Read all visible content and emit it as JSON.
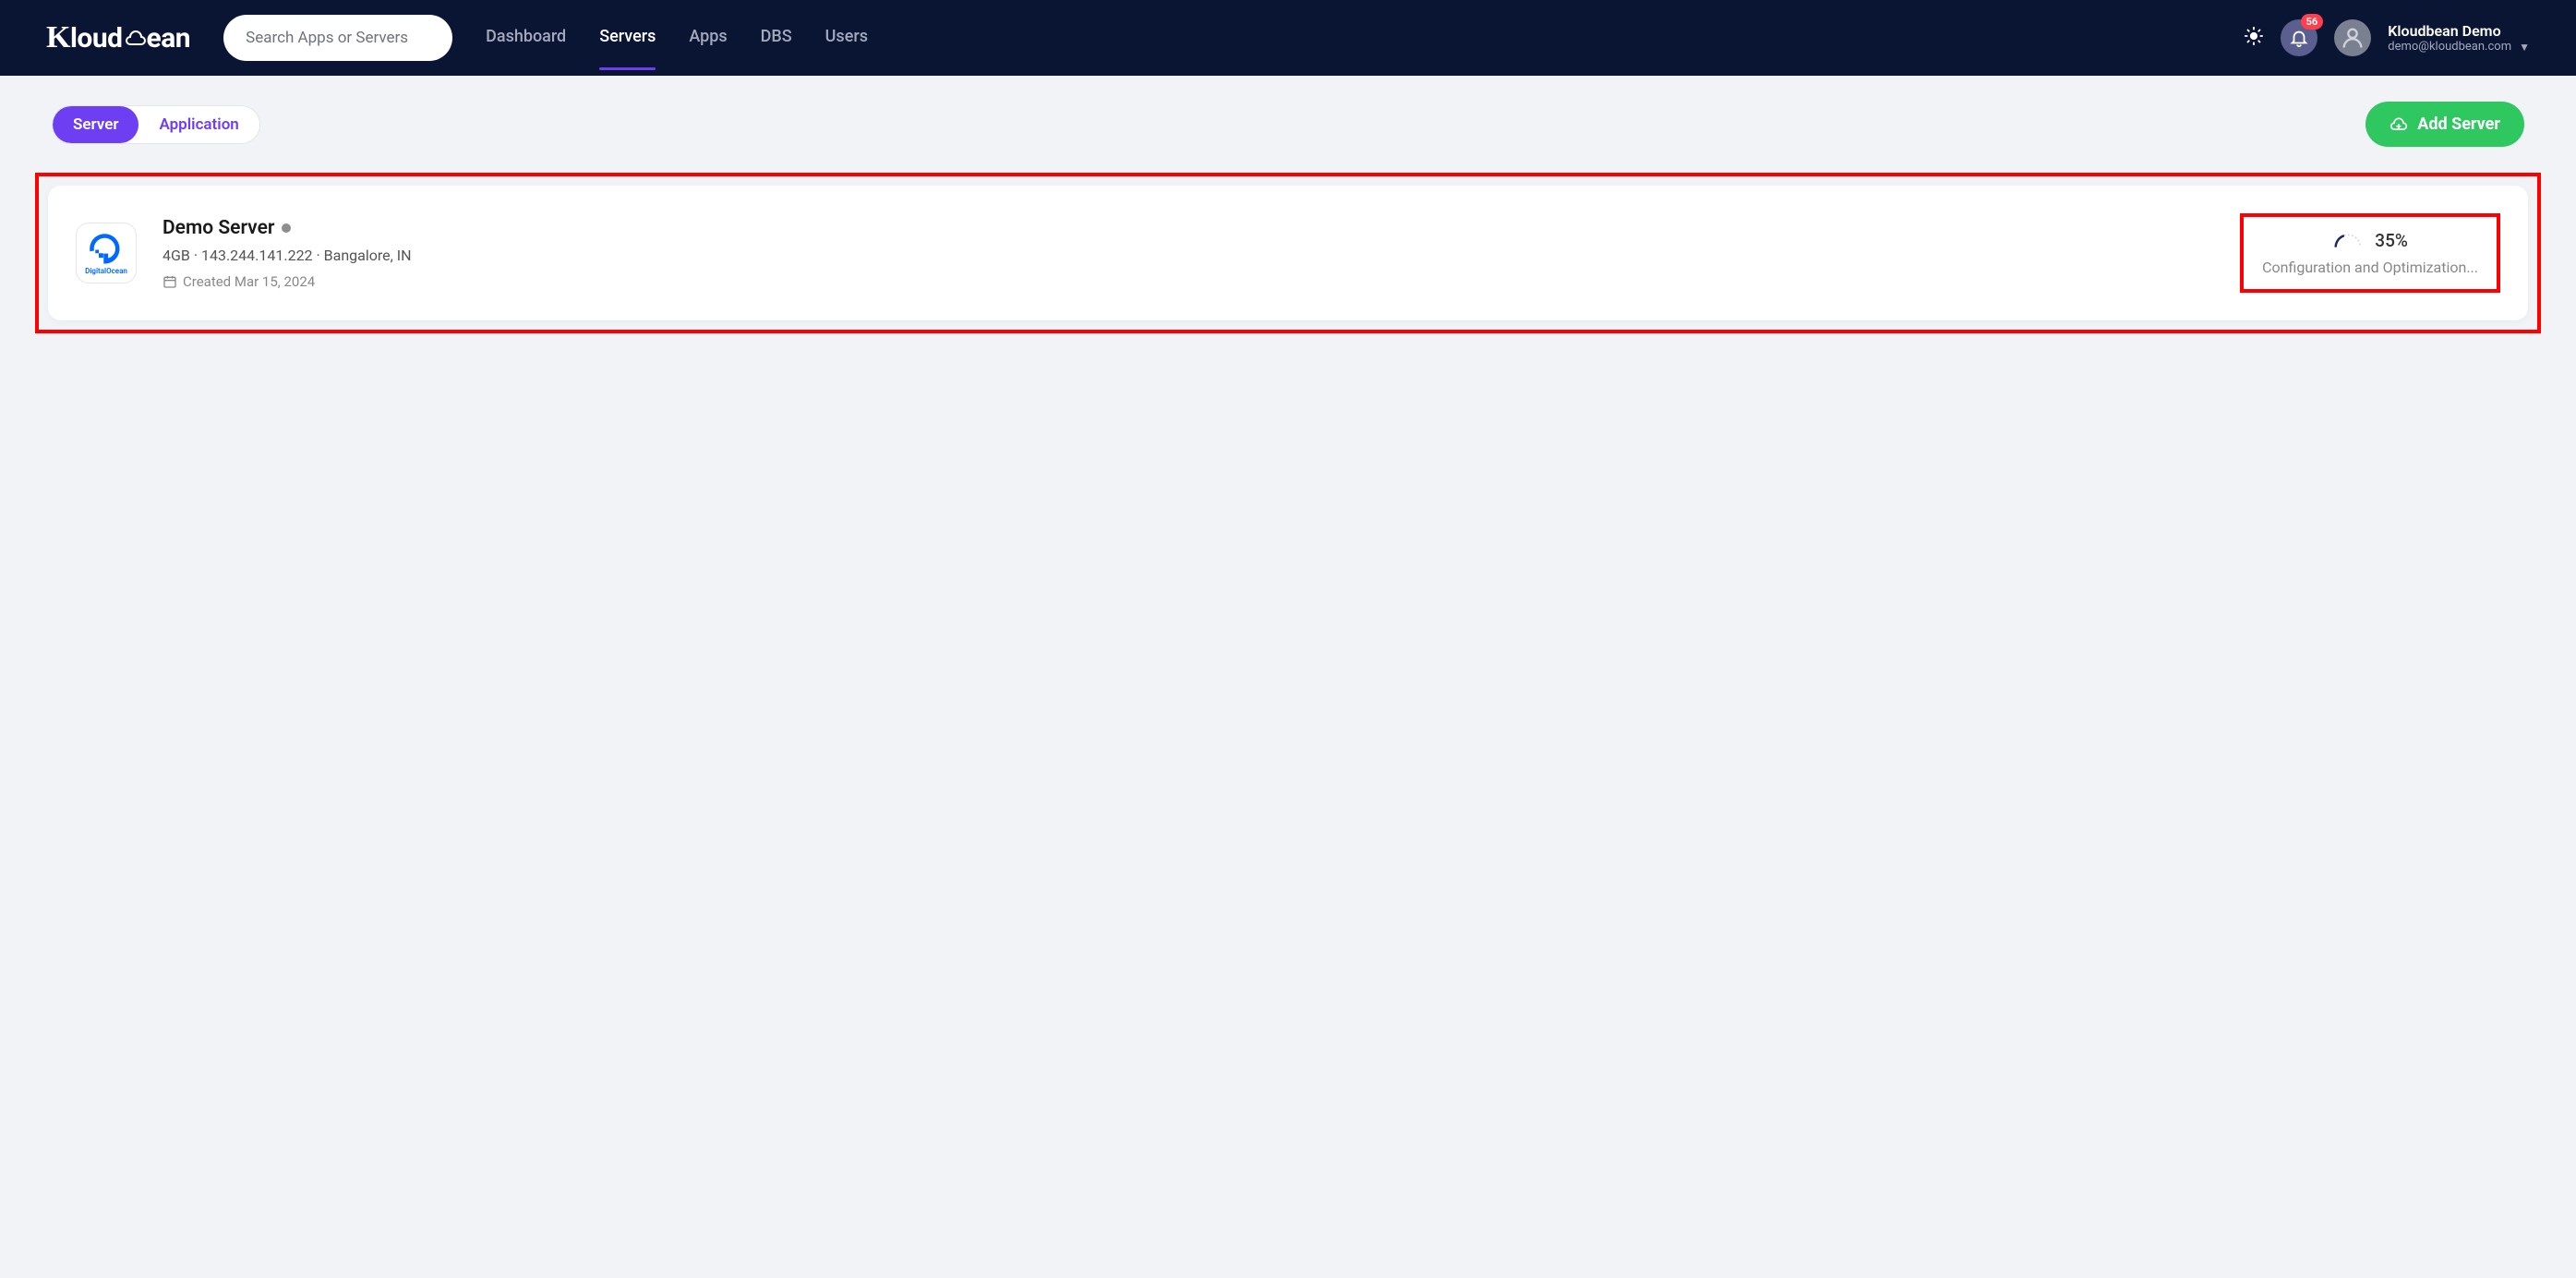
{
  "brand": "Kloudbean",
  "search": {
    "placeholder": "Search Apps or Servers"
  },
  "nav": [
    {
      "label": "Dashboard",
      "active": false
    },
    {
      "label": "Servers",
      "active": true
    },
    {
      "label": "Apps",
      "active": false
    },
    {
      "label": "DBS",
      "active": false
    },
    {
      "label": "Users",
      "active": false
    }
  ],
  "notifications": {
    "count": "56"
  },
  "user": {
    "name": "Kloudbean Demo",
    "email": "demo@kloudbean.com"
  },
  "tabs": {
    "server": "Server",
    "application": "Application"
  },
  "buttons": {
    "add_server": "Add Server"
  },
  "server": {
    "name": "Demo Server",
    "provider": "DigitalOcean",
    "ram": "4GB",
    "ip": "143.244.141.222",
    "location": "Bangalore, IN",
    "created_label": "Created Mar 15, 2024",
    "progress_percent": "35%",
    "progress_label": "Configuration and Optimization..."
  }
}
